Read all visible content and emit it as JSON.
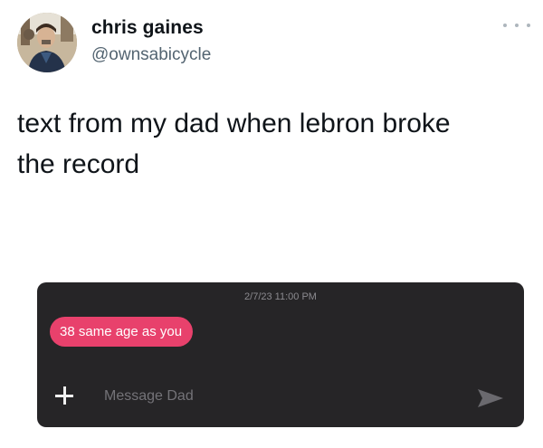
{
  "tweet": {
    "author_name": "chris gaines",
    "author_handle": "@ownsabicycle",
    "text": "text from my dad when lebron broke\nthe record",
    "more_icon": "more-horizontal-icon"
  },
  "sms": {
    "timestamp": "2/7/23 11:00 PM",
    "message": "38 same age as you",
    "input_placeholder": "Message Dad",
    "input_value": "",
    "add_icon": "plus-icon",
    "send_icon": "send-arrow-icon",
    "colors": {
      "panel": "#262527",
      "bubble": "#e8416c"
    }
  }
}
